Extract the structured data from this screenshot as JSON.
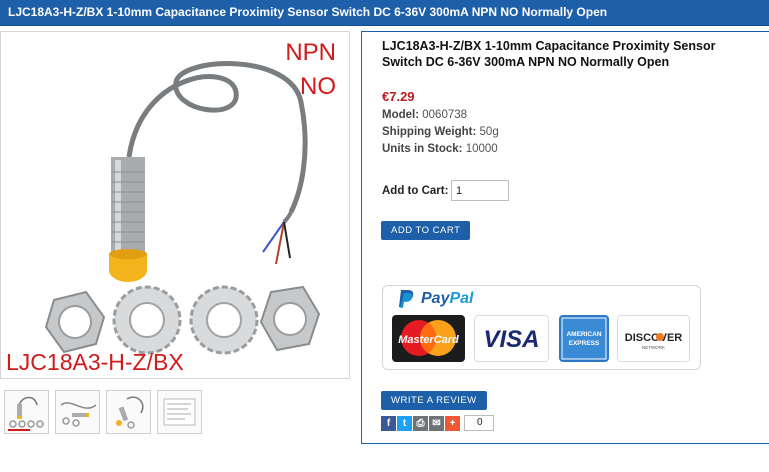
{
  "page_title": "LJC18A3-H-Z/BX 1-10mm Capacitance Proximity Sensor Switch DC 6-36V 300mA NPN NO Normally Open",
  "image_overlay": {
    "line1": "NPN",
    "line2": "NO",
    "model": "LJC18A3-H-Z/BX"
  },
  "product": {
    "name": "LJC18A3-H-Z/BX 1-10mm Capacitance Proximity Sensor Switch DC 6-36V 300mA NPN NO Normally Open",
    "price": "€7.29",
    "model_label": "Model:",
    "model_value": "0060738",
    "weight_label": "Shipping Weight:",
    "weight_value": "50g",
    "stock_label": "Units in Stock:",
    "stock_value": "10000"
  },
  "cart": {
    "label": "Add to Cart:",
    "quantity": "1",
    "button_label": "ADD TO CART"
  },
  "payment": {
    "paypal_text_1": "Pay",
    "paypal_text_2": "Pal",
    "cards": [
      "MasterCard",
      "VISA",
      "AMERICAN EXPRESS",
      "DISCOVER"
    ]
  },
  "review_button_label": "WRITE A REVIEW",
  "share": {
    "count": "0",
    "icons": [
      "facebook-icon",
      "twitter-icon",
      "print-icon",
      "email-icon",
      "plus-icon"
    ]
  },
  "colors": {
    "brand_blue": "#1d5fa9",
    "price_red": "#b81d1d",
    "overlay_red": "#d11a1a"
  }
}
